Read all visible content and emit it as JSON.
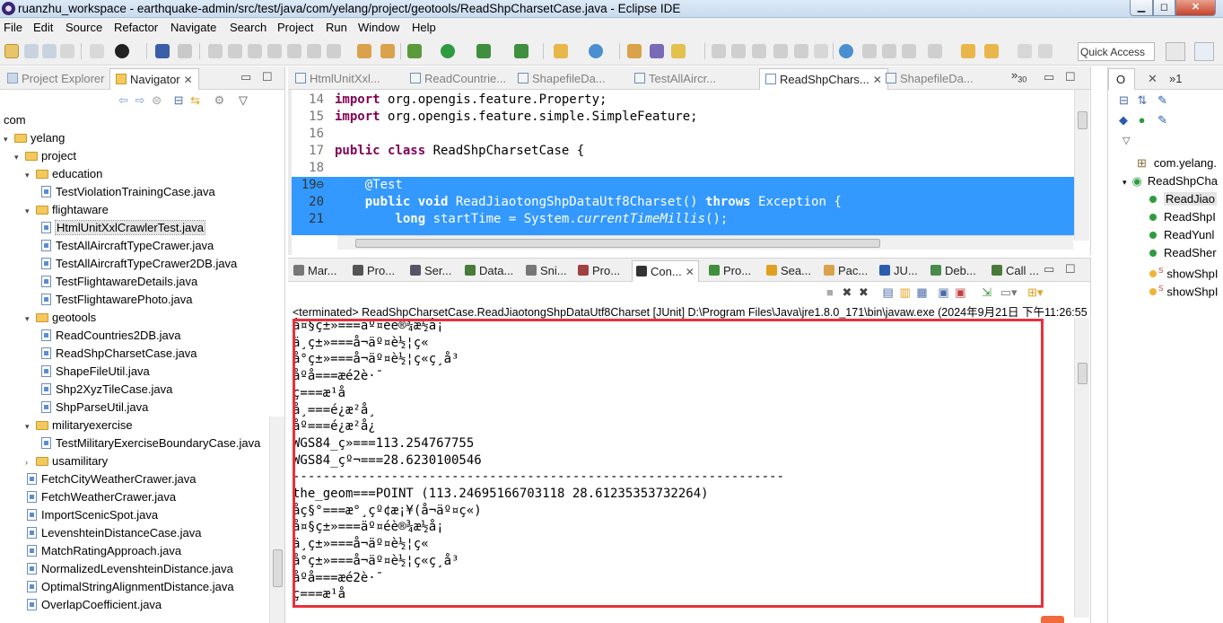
{
  "window": {
    "title": "ruanzhu_workspace - earthquake-admin/src/test/java/com/yelang/project/geotools/ReadShpCharsetCase.java - Eclipse IDE",
    "minimize": "▁",
    "maximize": "◻",
    "close": "✕"
  },
  "menu": [
    "File",
    "Edit",
    "Source",
    "Refactor",
    "Navigate",
    "Search",
    "Project",
    "Run",
    "Window",
    "Help"
  ],
  "toolbar": {
    "quick_access": "Quick Access"
  },
  "left_panel": {
    "tabs": [
      {
        "label": "Project Explorer"
      },
      {
        "label": "Navigator",
        "close": "✕"
      }
    ],
    "tree": [
      {
        "label": "com",
        "kind": "text"
      },
      {
        "label": "yelang",
        "kind": "folder",
        "arrow": "▾"
      },
      {
        "label": "project",
        "kind": "folder",
        "arrow": "▾"
      },
      {
        "label": "education",
        "kind": "folder",
        "arrow": "▾"
      },
      {
        "label": "TestViolationTrainingCase.java",
        "kind": "file"
      },
      {
        "label": "flightaware",
        "kind": "folder",
        "arrow": "▾"
      },
      {
        "label": "HtmlUnitXxlCrawlerTest.java",
        "kind": "file",
        "selected": true
      },
      {
        "label": "TestAllAircraftTypeCrawer.java",
        "kind": "file"
      },
      {
        "label": "TestAllAircraftTypeCrawer2DB.java",
        "kind": "file"
      },
      {
        "label": "TestFlightawareDetails.java",
        "kind": "file"
      },
      {
        "label": "TestFlightawarePhoto.java",
        "kind": "file"
      },
      {
        "label": "geotools",
        "kind": "folder",
        "arrow": "▾"
      },
      {
        "label": "ReadCountries2DB.java",
        "kind": "file"
      },
      {
        "label": "ReadShpCharsetCase.java",
        "kind": "file"
      },
      {
        "label": "ShapeFileUtil.java",
        "kind": "file"
      },
      {
        "label": "Shp2XyzTileCase.java",
        "kind": "file"
      },
      {
        "label": "ShpParseUtil.java",
        "kind": "file"
      },
      {
        "label": "militaryexercise",
        "kind": "folder",
        "arrow": "▾"
      },
      {
        "label": "TestMilitaryExerciseBoundaryCase.java",
        "kind": "file"
      },
      {
        "label": "usamilitary",
        "kind": "folder",
        "arrow": "›"
      },
      {
        "label": "FetchCityWeatherCrawer.java",
        "kind": "file"
      },
      {
        "label": "FetchWeatherCrawer.java",
        "kind": "file"
      },
      {
        "label": "ImportScenicSpot.java",
        "kind": "file"
      },
      {
        "label": "LevenshteinDistanceCase.java",
        "kind": "file"
      },
      {
        "label": "MatchRatingApproach.java",
        "kind": "file"
      },
      {
        "label": "NormalizedLevenshteinDistance.java",
        "kind": "file"
      },
      {
        "label": "OptimalStringAlignmentDistance.java",
        "kind": "file"
      },
      {
        "label": "OverlapCoefficient.java",
        "kind": "file"
      }
    ]
  },
  "editor": {
    "tabs": [
      {
        "label": "HtmlUnitXxl..."
      },
      {
        "label": "ReadCountrie..."
      },
      {
        "label": "ShapefileDa..."
      },
      {
        "label": "TestAllAircr..."
      },
      {
        "label": "ReadShpChars...",
        "active": true,
        "close": "✕"
      },
      {
        "label": "ShapefileDa..."
      }
    ],
    "overflow": "»",
    "overflow_count": "30",
    "lines": [
      {
        "num": "14",
        "parts": [
          {
            "t": "import ",
            "c": "kw"
          },
          {
            "t": "org.opengis.feature.Property;"
          }
        ]
      },
      {
        "num": "15",
        "parts": [
          {
            "t": "import ",
            "c": "kw"
          },
          {
            "t": "org.opengis.feature.simple.SimpleFeature;"
          }
        ]
      },
      {
        "num": "16",
        "parts": []
      },
      {
        "num": "17",
        "parts": [
          {
            "t": "public class ",
            "c": "kw"
          },
          {
            "t": "ReadShpCharsetCase {"
          }
        ]
      },
      {
        "num": "18",
        "parts": []
      },
      {
        "num": "19⊖",
        "sel": true,
        "parts": [
          {
            "t": "    @Test",
            "c": "ann"
          }
        ]
      },
      {
        "num": "20",
        "sel": true,
        "parts": [
          {
            "t": "    public void ",
            "c": "kw"
          },
          {
            "t": "ReadJiaotongShpDataUtf8Charset() "
          },
          {
            "t": "throws ",
            "c": "kw"
          },
          {
            "t": "Exception {"
          }
        ]
      },
      {
        "num": "21",
        "sel": true,
        "parts": [
          {
            "t": "        long ",
            "c": "kw"
          },
          {
            "t": "startTime = System."
          },
          {
            "t": "currentTimeMillis",
            "c": "it"
          },
          {
            "t": "();"
          }
        ]
      }
    ]
  },
  "console": {
    "tabs": [
      {
        "label": "Mar..."
      },
      {
        "label": "Pro..."
      },
      {
        "label": "Ser..."
      },
      {
        "label": "Data..."
      },
      {
        "label": "Sni..."
      },
      {
        "label": "Pro..."
      },
      {
        "label": "Con...",
        "active": true,
        "close": "✕"
      },
      {
        "label": "Pro..."
      },
      {
        "label": "Sea..."
      },
      {
        "label": "Pac..."
      },
      {
        "label": "JU..."
      },
      {
        "label": "Deb..."
      },
      {
        "label": "Call ..."
      }
    ],
    "status": "<terminated> ReadShpCharsetCase.ReadJiaotongShpDataUtf8Charset [JUnit] D:\\Program Files\\Java\\jre1.8.0_171\\bin\\javaw.exe (2024年9月21日 下午11:26:55",
    "lines": [
      "å¤§ç±»===äº¤éè®¾æ½å¡",
      "ä¸­ç±»===å¬äº¤è½¦ç«",
      "å°ç±»===å¬äº¤è½¦ç«ç¸å³",
      "åºå===æé2è·¯",
      "ç===æ¹å",
      "å¸===é¿æ²å¸",
      "åº===é¿æ²å¿",
      "WGS84_ç»===113.254767755",
      "WGS84_çº¬===28.6230100546",
      "-----------------------------------------------------------------",
      "the_geom===POINT (113.24695166703118 28.61235353732264)",
      "åç§°===æ°¸çº¢æ¡¥(å¬äº¤ç«)",
      "å¤§ç±»===äº¤éè®¾æ½å¡",
      "ä¸­ç±»===å¬äº¤è½¦ç«",
      "å°ç±»===å¬äº¤è½¦ç«ç¸å³",
      "åºå===æé2è·¯",
      "ç===æ¹å"
    ]
  },
  "outline": {
    "tabs": [
      {
        "label": "O"
      },
      {
        "label": "✕"
      },
      {
        "label": "»1"
      }
    ],
    "items": [
      {
        "label": "com.yelang.",
        "kind": "package"
      },
      {
        "label": "ReadShpCha",
        "kind": "class"
      },
      {
        "label": "ReadJiao",
        "kind": "method",
        "selected": true
      },
      {
        "label": "ReadShpI",
        "kind": "method"
      },
      {
        "label": "ReadYunl",
        "kind": "method"
      },
      {
        "label": "ReadSher",
        "kind": "method"
      },
      {
        "label": "showShpI",
        "kind": "static"
      },
      {
        "label": "showShpI",
        "kind": "static"
      }
    ],
    "static_mark": "S"
  },
  "colors": {
    "selection": "#3399ff",
    "keyword": "#7f0055",
    "highlight_box": "#e8313a",
    "method_green": "#2e9b41",
    "static_orange": "#f0b437"
  }
}
